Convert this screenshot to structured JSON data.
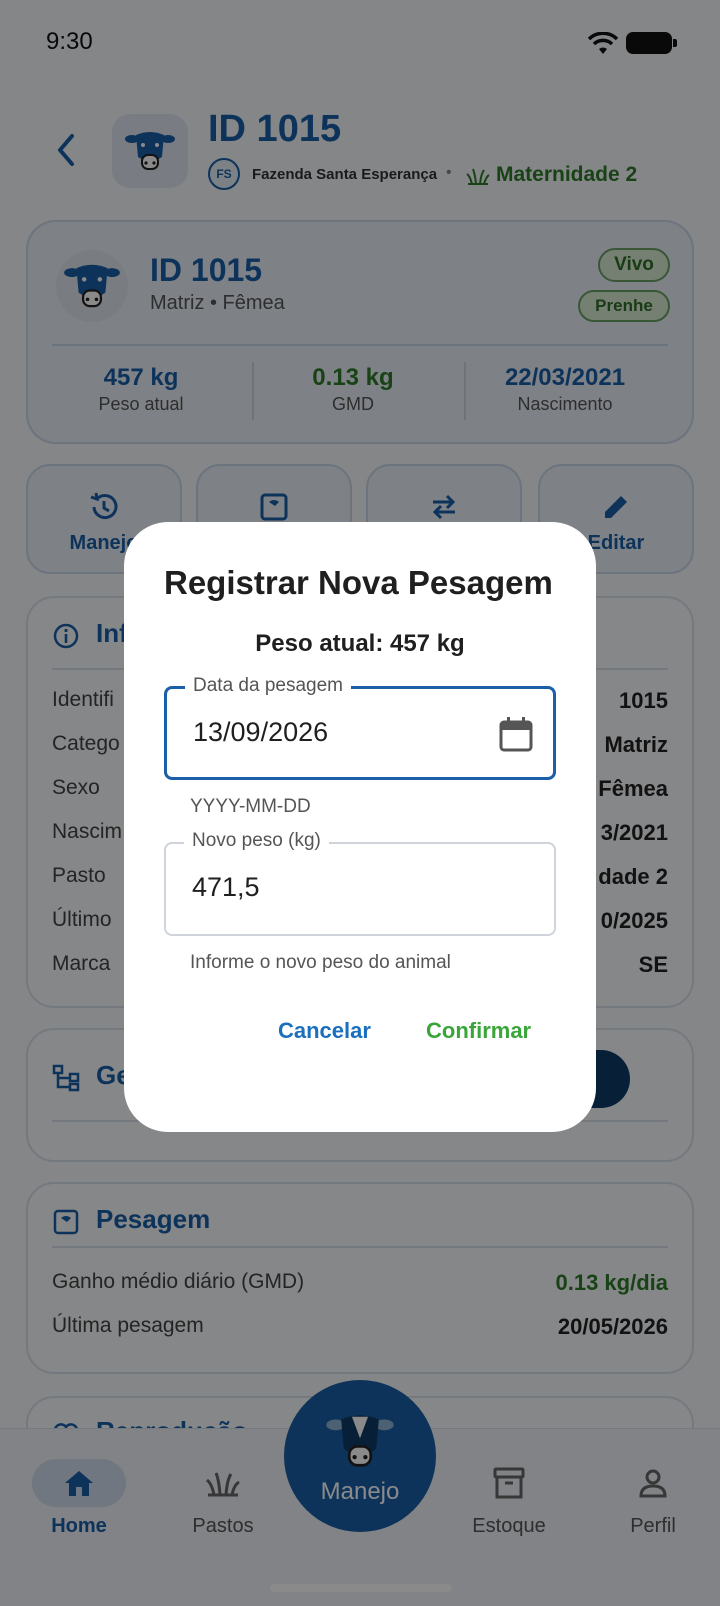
{
  "status_bar": {
    "time": "9:30"
  },
  "header": {
    "title": "ID 1015",
    "farm_initials": "FS",
    "farm_name": "Fazenda Santa Esperança",
    "separator": "•",
    "pasture": "Maternidade 2"
  },
  "profile": {
    "title": "ID 1015",
    "subtitle": "Matriz • Fêmea",
    "chips": [
      "Vivo",
      "Prenhe"
    ],
    "stats": [
      {
        "value": "457 kg",
        "label": "Peso atual"
      },
      {
        "value": "0.13 kg",
        "label": "GMD"
      },
      {
        "value": "22/03/2021",
        "label": "Nascimento"
      }
    ]
  },
  "actions": [
    {
      "label": "Manejo",
      "icon": "history-icon"
    },
    {
      "label": "",
      "icon": "scale-icon"
    },
    {
      "label": "",
      "icon": "transfer-icon"
    },
    {
      "label": "Editar",
      "icon": "edit-icon"
    }
  ],
  "info_card": {
    "title": "Inf",
    "rows": [
      {
        "label": "Identifi",
        "value": "1015"
      },
      {
        "label": "Catego",
        "value": "Matriz"
      },
      {
        "label": "Sexo",
        "value": "Fêmea"
      },
      {
        "label": "Nascim",
        "value": "3/2021"
      },
      {
        "label": "Pasto",
        "value": "dade 2"
      },
      {
        "label": "Último",
        "value": "0/2025"
      },
      {
        "label": "Marca",
        "value": "SE"
      }
    ]
  },
  "genealogy_card": {
    "title": "Ge"
  },
  "weighing_card": {
    "title": "Pesagem",
    "rows": [
      {
        "label": "Ganho médio diário (GMD)",
        "value": "0.13 kg/dia"
      },
      {
        "label": "Última pesagem",
        "value": "20/05/2026"
      }
    ]
  },
  "reproduction_card": {
    "title": "Reprodução"
  },
  "bottom_nav": {
    "items": [
      {
        "label": "Home",
        "icon": "home-icon",
        "active": true
      },
      {
        "label": "Pastos",
        "icon": "pasture-icon"
      },
      {
        "label": "Estoque",
        "icon": "archive-icon"
      },
      {
        "label": "Perfil",
        "icon": "person-icon"
      }
    ],
    "fab_label": "Manejo"
  },
  "dialog": {
    "title": "Registrar Nova Pesagem",
    "current_weight": "Peso atual: 457 kg",
    "date_field": {
      "label": "Data da pesagem",
      "value": "13/09/2026",
      "helper": "YYYY-MM-DD"
    },
    "weight_field": {
      "label": "Novo peso (kg)",
      "value": "471,5",
      "helper": "Informe o novo peso do animal"
    },
    "cancel_label": "Cancelar",
    "confirm_label": "Confirmar"
  },
  "colors": {
    "primary": "#1b5fa8",
    "green": "#2f7d2a",
    "confirm": "#3aa63a"
  }
}
